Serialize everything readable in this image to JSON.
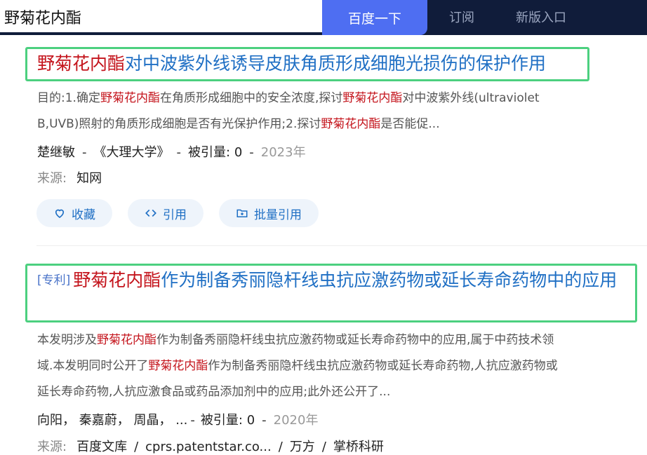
{
  "header": {
    "search_query": "野菊花内酯",
    "search_button": "百度一下",
    "nav": {
      "subscribe": "订阅",
      "new_version": "新版入口"
    }
  },
  "results": [
    {
      "title_highlight": "野菊花内酯",
      "title_rest": "对中波紫外线诱导皮肤角质形成细胞光损伤的保护作用",
      "abstract": {
        "line1": [
          "目的:1.确定",
          "野菊花内酯",
          "在角质形成细胞中的安全浓度,探讨",
          "野菊花内酯",
          "对中波紫外线(ultraviolet"
        ],
        "line2": [
          "B,UVB)照射的角质形成细胞是否有光保护作用;2.探讨",
          "野菊花内酯",
          "是否能促..."
        ]
      },
      "meta": {
        "author": "楚继敏",
        "journal": "《大理大学》",
        "citations_label": "被引量:",
        "citations": "0",
        "year": "2023年",
        "sep": "-"
      },
      "source_label": "来源:",
      "sources": [
        "知网"
      ],
      "actions": {
        "favorite": "收藏",
        "cite": "引用",
        "batch_cite": "批量引用"
      }
    },
    {
      "tag": "[专利]",
      "title_highlight": "野菊花内酯",
      "title_rest": "作为制备秀丽隐杆线虫抗应激药物或延长寿命药物中的应用",
      "abstract": {
        "line1": [
          "本发明涉及",
          "野菊花内酯",
          "作为制备秀丽隐杆线虫抗应激药物或延长寿命药物中的应用,属于中药技术领"
        ],
        "line2": [
          "域.本发明同时公开了",
          "野菊花内酯",
          "作为制备秀丽隐杆线虫抗应激药物或延长寿命药物,人抗应激药物或"
        ],
        "line3": "延长寿命药物,人抗应激食品或药品添加剂中的应用;此外还公开了..."
      },
      "meta": {
        "authors": [
          "向阳，",
          "秦嘉蔚，",
          "周晶，",
          "..."
        ],
        "citations_label": "被引量:",
        "citations": "0",
        "year": "2020年",
        "sep": "-"
      },
      "source_label": "来源:",
      "sources": [
        "百度文库",
        "cprs.patentstar.co...",
        "万方",
        "掌桥科研"
      ],
      "source_sep": "/"
    }
  ],
  "colors": {
    "header_bg": "#101c3a",
    "search_button": "#4e6ef2",
    "title_link": "#1f6fc4",
    "highlight": "#c4141c",
    "focus_border": "#4cd07f"
  },
  "icons": {
    "favorite": "heart-icon",
    "cite": "code-brackets-icon",
    "batch_cite": "folder-plus-icon"
  }
}
